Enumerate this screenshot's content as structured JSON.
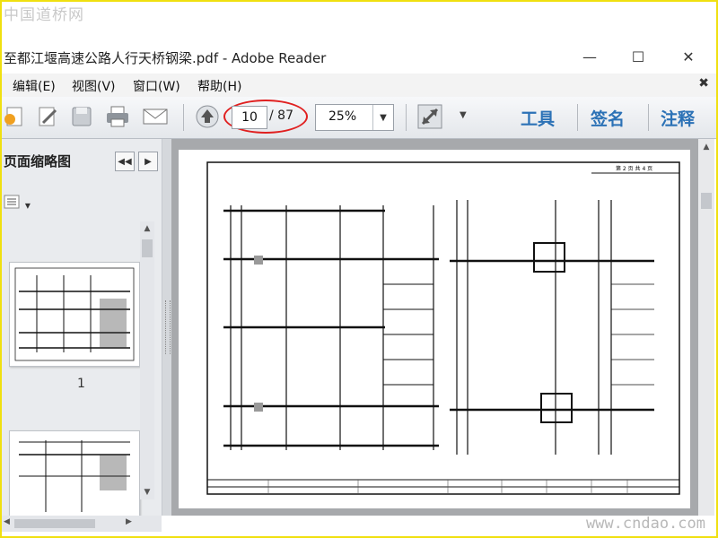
{
  "watermark": {
    "top": "中国道桥网",
    "bottom": "www.cndao.com"
  },
  "window": {
    "title": "至都江堰高速公路人行天桥钢梁.pdf - Adobe Reader",
    "minimize_glyph": "—",
    "maximize_glyph": "☐",
    "close_glyph": "✕"
  },
  "menu": {
    "items": [
      {
        "label": "编辑(E)"
      },
      {
        "label": "视图(V)"
      },
      {
        "label": "窗口(W)"
      },
      {
        "label": "帮助(H)"
      }
    ],
    "close_glyph": "✖"
  },
  "toolbar": {
    "current_page": "10",
    "total_pages": "/ 87",
    "zoom": "25%",
    "zoom_arrow": "▼",
    "more_arrow": "▼",
    "links": {
      "tools": "工具",
      "sign": "签名",
      "comment": "注释"
    },
    "highlight_color": "#e02020",
    "link_color": "#2c72b6"
  },
  "sidebar": {
    "title": "页面缩略图",
    "prev_glyph": "◀◀",
    "next_glyph": "▶",
    "options_glyph": "▾",
    "thumbnails": [
      {
        "label": "1"
      }
    ]
  },
  "document": {
    "sheet_header": "第 2 页   共 4 页"
  }
}
